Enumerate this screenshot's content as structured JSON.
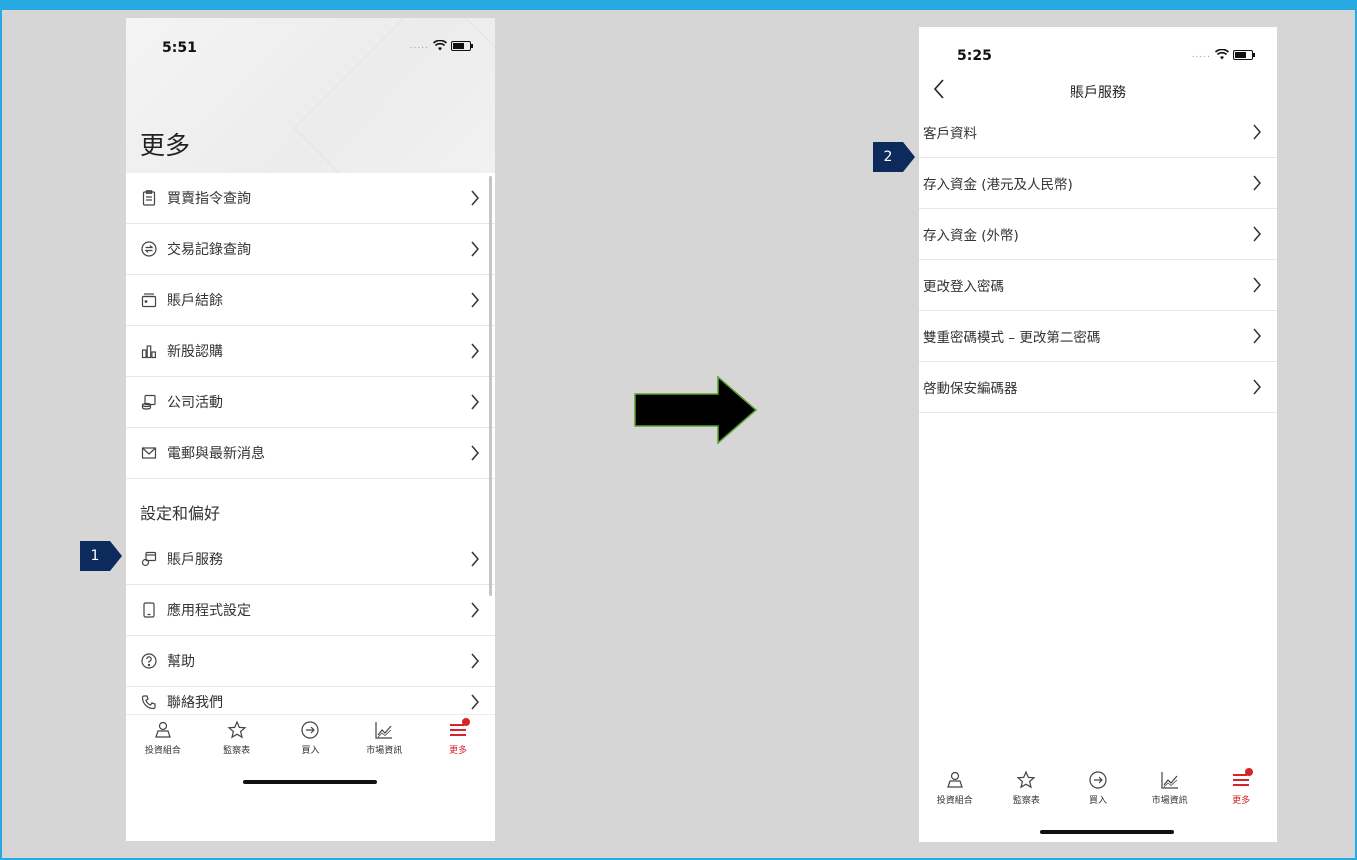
{
  "colors": {
    "frame_border": "#29a9e1",
    "canvas_bg": "#d6d6d6",
    "accent_red": "#d8232a",
    "step_marker": "#0c2a5b",
    "flow_arrow_fill": "#000000",
    "flow_arrow_stroke": "#5aa02c"
  },
  "steps": [
    {
      "number": "1",
      "points_to": "賬戶服務"
    },
    {
      "number": "2",
      "points_to": "存入資金 (港元及人民幣)"
    }
  ],
  "left_screen": {
    "status": {
      "time": "5:51",
      "signal": "....."
    },
    "title": "更多",
    "menu_items": [
      {
        "label": "買賣指令查詢",
        "icon": "clipboard-icon"
      },
      {
        "label": "交易記錄查詢",
        "icon": "exchange-icon"
      },
      {
        "label": "賬戶結餘",
        "icon": "wallet-icon"
      },
      {
        "label": "新股認購",
        "icon": "bar-chart-icon"
      },
      {
        "label": "公司活動",
        "icon": "coins-icon"
      },
      {
        "label": "電郵與最新消息",
        "icon": "mail-icon"
      }
    ],
    "section_title": "設定和偏好",
    "settings_items": [
      {
        "label": "賬戶服務",
        "icon": "account-service-icon"
      },
      {
        "label": "應用程式設定",
        "icon": "phone-icon"
      },
      {
        "label": "幫助",
        "icon": "help-icon"
      },
      {
        "label": "聯絡我們",
        "icon": "contact-phone-icon"
      }
    ]
  },
  "right_screen": {
    "status": {
      "time": "5:25",
      "signal": "....."
    },
    "title": "賬戶服務",
    "menu_items": [
      {
        "label": "客戶資料"
      },
      {
        "label": "存入資金 (港元及人民幣)"
      },
      {
        "label": "存入資金 (外幣)"
      },
      {
        "label": "更改登入密碼"
      },
      {
        "label": "雙重密碼模式 – 更改第二密碼"
      },
      {
        "label": "啓動保安編碼器"
      }
    ]
  },
  "tabbar": {
    "tabs": [
      {
        "label": "投資組合",
        "icon": "portfolio-icon"
      },
      {
        "label": "監察表",
        "icon": "star-icon"
      },
      {
        "label": "買入",
        "icon": "buy-arrow-icon"
      },
      {
        "label": "市場資訊",
        "icon": "market-chart-icon"
      },
      {
        "label": "更多",
        "icon": "menu-icon",
        "active": true
      }
    ]
  }
}
